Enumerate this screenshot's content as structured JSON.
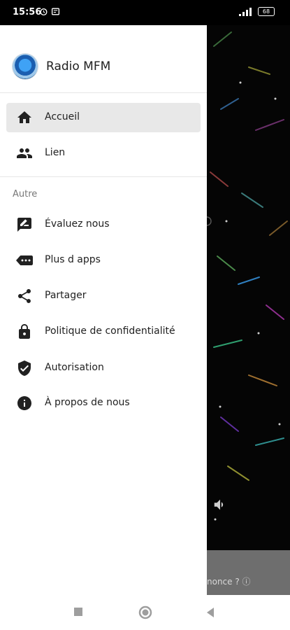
{
  "status_bar": {
    "time": "15:56",
    "battery": "68"
  },
  "drawer": {
    "app_name": "Radio MFM",
    "main_items": [
      {
        "label": "Accueil",
        "icon": "home-icon",
        "active": true
      },
      {
        "label": "Lien",
        "icon": "people-icon",
        "active": false
      }
    ],
    "section_title": "Autre",
    "other_items": [
      {
        "label": "Évaluez nous",
        "icon": "rate-review-icon"
      },
      {
        "label": "Plus d apps",
        "icon": "more-apps-icon"
      },
      {
        "label": "Partager",
        "icon": "share-icon"
      },
      {
        "label": "Politique de confidentialité",
        "icon": "lock-icon"
      },
      {
        "label": "Autorisation",
        "icon": "verified-shield-icon"
      },
      {
        "label": "À propos de nous",
        "icon": "info-icon"
      }
    ]
  },
  "background": {
    "ad_text": "nonce ? ⓘ"
  },
  "colors": {
    "drawer_bg": "#ffffff",
    "active_item_bg": "#e8e8e8",
    "text_primary": "#212121",
    "section_text": "#777777",
    "app_bg": "#050505"
  }
}
